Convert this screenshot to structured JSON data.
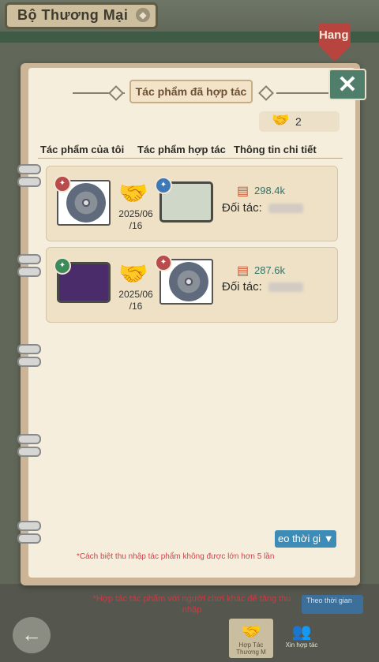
{
  "header": {
    "title": "Bộ Thương Mại",
    "hang_label": "Hang"
  },
  "dialog": {
    "tab_title": "Tác phẩm đã hợp tác",
    "close_symbol": "✕",
    "partner_count": "2",
    "columns": [
      "Tác phẩm của tôi",
      "Tác phẩm hợp tác",
      "Thông tin chi tiết"
    ],
    "rows": [
      {
        "date_line1": "2025/06",
        "date_line2": "/16",
        "income": "298.4k",
        "partner_label": "Đối tác:"
      },
      {
        "date_line1": "2025/06",
        "date_line2": "/16",
        "income": "287.6k",
        "partner_label": "Đối tác:"
      }
    ],
    "sort_label": "eo thời gi",
    "notice": "*Cách biệt thu nhập tác phẩm không được lớn hơn 5 lần"
  },
  "footer": {
    "note": "*Hợp tác tác phẩm với người chơi khác để tăng thu nhập",
    "sort_label": "Theo thời gian",
    "tab1_label": "Hợp Tác Thương M",
    "tab2_label": "Xin hợp tác"
  },
  "icons": {
    "handshake": "handshake-icon",
    "coin": "coin-stack-icon",
    "back": "back-arrow-icon",
    "close": "close-icon"
  },
  "colors": {
    "accent_green": "#3e7a6a",
    "income_green": "#2f7468",
    "notice_red": "#d6404a",
    "sort_blue": "#3d8cb8"
  }
}
